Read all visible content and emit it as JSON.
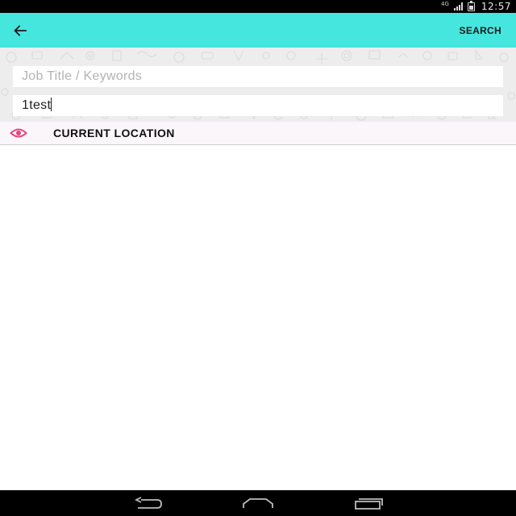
{
  "status_bar": {
    "network_label": "4G",
    "time": "12:57"
  },
  "app_bar": {
    "back_icon": "arrow-left-icon",
    "search_label": "SEARCH",
    "background_color": "#45e6dd"
  },
  "search_form": {
    "keywords": {
      "value": "",
      "placeholder": "Job Title / Keywords"
    },
    "location": {
      "value": "1test",
      "placeholder": ""
    }
  },
  "location_suggestion": {
    "icon": "eye-icon",
    "label": "CURRENT LOCATION",
    "accent_color": "#e8457a"
  },
  "nav_bar": {
    "buttons": [
      "back-icon",
      "home-icon",
      "recents-icon"
    ]
  }
}
